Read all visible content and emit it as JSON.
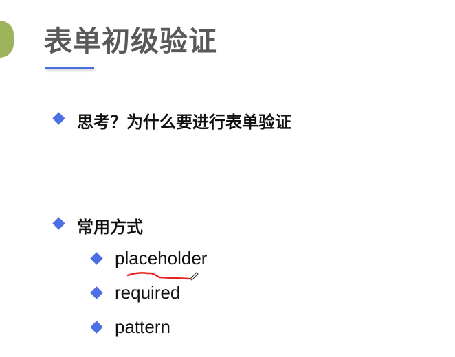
{
  "slide": {
    "title": "表单初级验证",
    "accent_color": "#4d6fe6",
    "bullets": [
      {
        "text": "思考？为什么要进行表单验证"
      },
      {
        "text": "常用方式",
        "children": [
          "placeholder",
          "required",
          "pattern"
        ]
      }
    ],
    "annotation_color": "#e8211b"
  }
}
